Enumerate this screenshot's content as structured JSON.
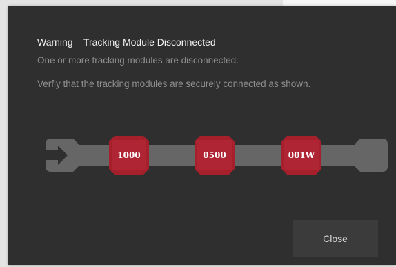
{
  "dialog": {
    "title": "Warning – Tracking Module Disconnected",
    "message_line1": "One or more tracking modules are disconnected.",
    "message_line2": "Verfiy that the tracking modules are securely connected as shown.",
    "close_label": "Close"
  },
  "modules": [
    {
      "label": "1000",
      "color": "#a6202c"
    },
    {
      "label": "0500",
      "color": "#a6202c"
    },
    {
      "label": "001W",
      "color": "#a6202c"
    }
  ],
  "track_icon": "arrow-right-icon",
  "colors": {
    "dialog_bg": "#2f2f2f",
    "track": "#666666",
    "arrow": "#2f2f2f",
    "module": "#a6202c"
  }
}
